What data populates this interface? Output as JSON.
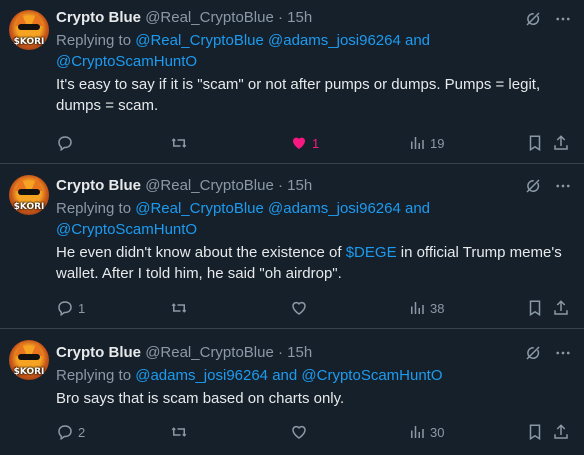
{
  "tweets": [
    {
      "name": "Crypto Blue",
      "handle": "@Real_CryptoBlue",
      "dot": "·",
      "time": "15h",
      "replying_prefix": "Replying to",
      "mentions": [
        "@Real_CryptoBlue",
        "@adams_josi96264",
        "@CryptoScamHuntO"
      ],
      "replying_join": "and",
      "text_before": "It's easy to say if it is \"scam\" or not after pumps or dumps. Pumps = legit, dumps = scam.",
      "text_link": "",
      "text_after": "",
      "replies": "",
      "retweets": "",
      "likes": "1",
      "views": "19",
      "liked": true
    },
    {
      "name": "Crypto Blue",
      "handle": "@Real_CryptoBlue",
      "dot": "·",
      "time": "15h",
      "replying_prefix": "Replying to",
      "mentions": [
        "@Real_CryptoBlue",
        "@adams_josi96264",
        "@CryptoScamHuntO"
      ],
      "replying_join": "and",
      "text_before": "He even didn't know about the existence of ",
      "text_link": "$DEGE",
      "text_after": " in official Trump meme's wallet. After I told him, he said \"oh airdrop\".",
      "replies": "1",
      "retweets": "",
      "likes": "",
      "views": "38",
      "liked": false
    },
    {
      "name": "Crypto Blue",
      "handle": "@Real_CryptoBlue",
      "dot": "·",
      "time": "15h",
      "replying_prefix": "Replying to",
      "mentions": [
        "@adams_josi96264",
        "@CryptoScamHuntO"
      ],
      "replying_join": "and",
      "text_before": "Bro says that is scam based on charts only.",
      "text_link": "",
      "text_after": "",
      "replies": "2",
      "retweets": "",
      "likes": "",
      "views": "30",
      "liked": false
    }
  ],
  "avatar_text": "$KORI",
  "icons": [
    "grok-icon",
    "more-icon",
    "reply-icon",
    "retweet-icon",
    "like-icon",
    "views-icon",
    "bookmark-icon",
    "share-icon"
  ],
  "colors": {
    "background": "#15202b",
    "text": "#e7e9ea",
    "muted": "#8b98a5",
    "link": "#1d9bf0",
    "like": "#f91880",
    "divider": "#38444d"
  }
}
